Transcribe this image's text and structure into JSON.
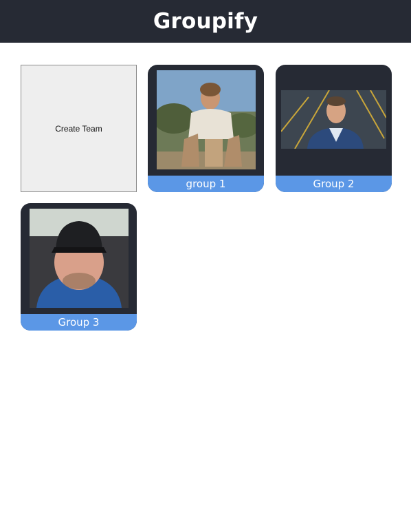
{
  "app": {
    "title": "Groupify"
  },
  "create_tile": {
    "label": "Create Team"
  },
  "groups": [
    {
      "name": "group 1",
      "photo": "person-outdoors-photo"
    },
    {
      "name": "Group 2",
      "photo": "person-suit-photo"
    },
    {
      "name": "Group 3",
      "photo": "person-cap-photo"
    }
  ],
  "colors": {
    "header_bg": "#262a34",
    "card_bg": "#262a34",
    "caption_bg": "#5b97e6",
    "create_bg": "#eeeeee"
  }
}
